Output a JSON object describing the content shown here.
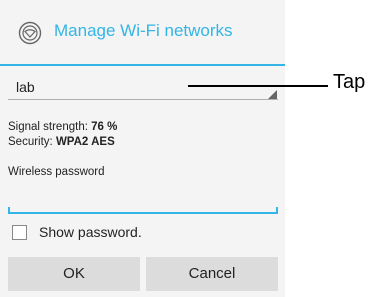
{
  "dialog": {
    "title": "Manage Wi-Fi networks",
    "icon": "wifi-settings-icon",
    "accent_color": "#33b5e5"
  },
  "network": {
    "selected": "lab"
  },
  "info": {
    "signal_label": "Signal strength:",
    "signal_value": "76 %",
    "security_label": "Security:",
    "security_value": "WPA2 AES"
  },
  "password": {
    "label": "Wireless password",
    "value": ""
  },
  "show_password": {
    "label": "Show password.",
    "checked": false
  },
  "buttons": {
    "ok": "OK",
    "cancel": "Cancel"
  },
  "annotation": {
    "text": "Tap"
  }
}
